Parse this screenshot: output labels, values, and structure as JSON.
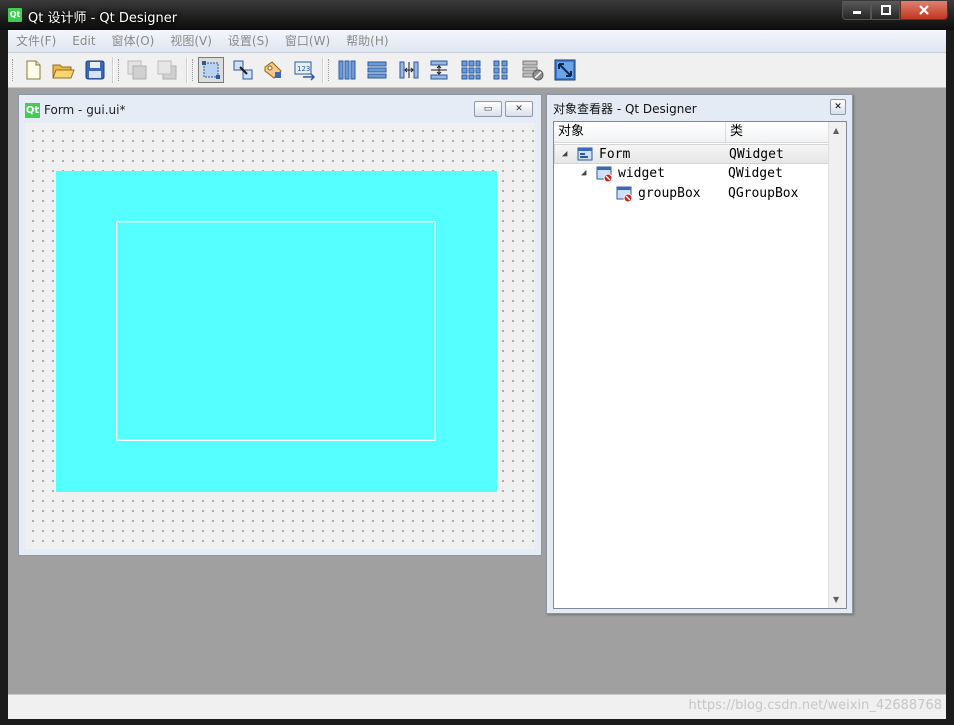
{
  "window": {
    "title": "Qt 设计师 - Qt Designer",
    "app_icon": "Qt",
    "minimize": "▁",
    "maximize": "□",
    "close": "✕"
  },
  "menu": [
    "文件(F)",
    "Edit",
    "窗体(O)",
    "视图(V)",
    "设置(S)",
    "窗口(W)",
    "帮助(H)"
  ],
  "toolbar": [
    {
      "name": "new-file-icon"
    },
    {
      "name": "open-folder-icon"
    },
    {
      "name": "save-icon"
    },
    {
      "name": "send-to-back-icon"
    },
    {
      "name": "bring-to-front-icon"
    },
    {
      "name": "edit-widgets-icon",
      "active": true
    },
    {
      "name": "edit-signals-slots-icon"
    },
    {
      "name": "edit-buddies-icon"
    },
    {
      "name": "edit-tab-order-icon"
    },
    {
      "name": "layout-horizontal-icon"
    },
    {
      "name": "layout-vertical-icon"
    },
    {
      "name": "layout-horizontal-splitter-icon"
    },
    {
      "name": "layout-vertical-splitter-icon"
    },
    {
      "name": "layout-grid-icon"
    },
    {
      "name": "layout-form-icon"
    },
    {
      "name": "break-layout-icon"
    },
    {
      "name": "adjust-size-icon"
    }
  ],
  "form_window": {
    "icon": "Qt",
    "title": "Form - gui.ui*",
    "minimize": "▭",
    "close": "✕",
    "widget_color": "#55ffff"
  },
  "inspector": {
    "title": "对象查看器 - Qt Designer",
    "close": "✕",
    "header_object": "对象",
    "header_class": "类",
    "rows": [
      {
        "name": "Form",
        "class": "QWidget"
      },
      {
        "name": "widget",
        "class": "QWidget"
      },
      {
        "name": "groupBox",
        "class": "QGroupBox"
      }
    ]
  },
  "status": {
    "watermark": "https://blog.csdn.net/weixin_42688768"
  },
  "colors": {
    "qt_green": "#41cd52",
    "widget_cyan": "#55ffff",
    "mdi_background": "#a0a0a0"
  }
}
